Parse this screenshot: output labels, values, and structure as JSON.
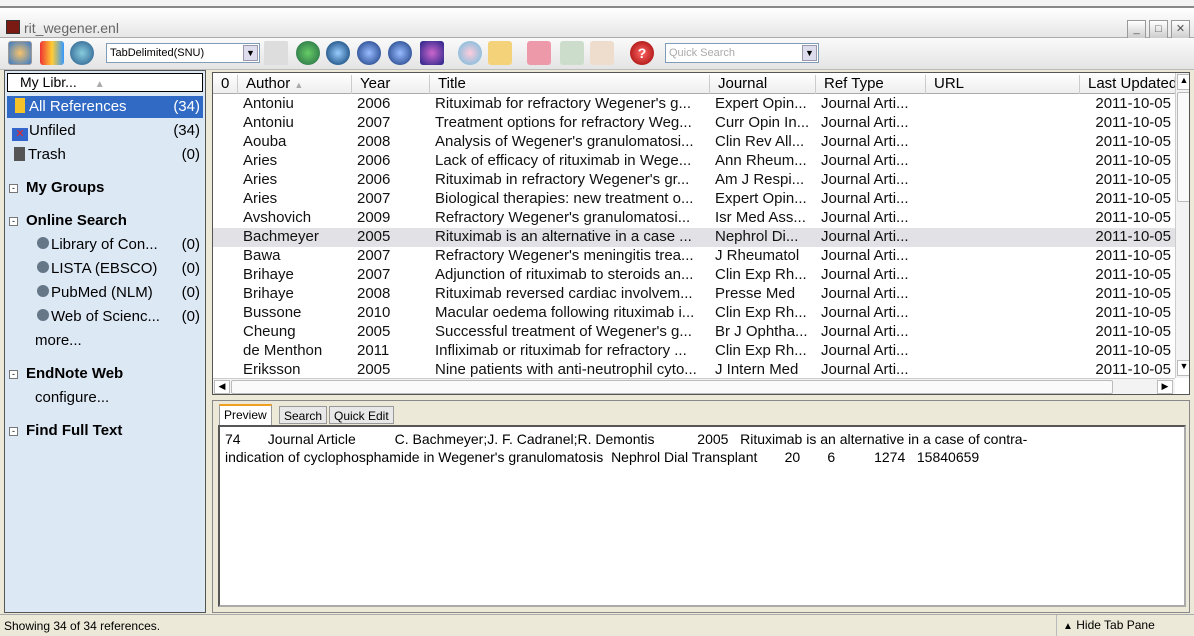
{
  "window": {
    "title": "rit_wegener.enl"
  },
  "toolbar": {
    "style_select": "TabDelimited(SNU)",
    "quick_search_placeholder": "Quick Search"
  },
  "sidebar": {
    "header": "My Libr...",
    "items": [
      {
        "label": "All References",
        "count": "(34)"
      },
      {
        "label": "Unfiled",
        "count": "(34)"
      },
      {
        "label": "Trash",
        "count": "(0)"
      }
    ],
    "groups": {
      "my_groups": "My Groups",
      "online_search": "Online Search",
      "endnote_web": "EndNote Web",
      "find_full_text": "Find Full Text"
    },
    "online": [
      {
        "label": "Library of Con...",
        "count": "(0)"
      },
      {
        "label": "LISTA (EBSCO)",
        "count": "(0)"
      },
      {
        "label": "PubMed (NLM)",
        "count": "(0)"
      },
      {
        "label": "Web of Scienc...",
        "count": "(0)"
      }
    ],
    "more": "more...",
    "configure": "configure..."
  },
  "table": {
    "columns": [
      "Author",
      "Year",
      "Title",
      "Journal",
      "Ref Type",
      "URL",
      "Last Updated"
    ],
    "selected_index": 7,
    "rows": [
      [
        "Antoniu",
        "2006",
        "Rituximab for refractory Wegener's g...",
        "Expert Opin...",
        "Journal Arti...",
        "",
        "2011-10-05"
      ],
      [
        "Antoniu",
        "2007",
        "Treatment options for refractory Weg...",
        "Curr Opin In...",
        "Journal Arti...",
        "",
        "2011-10-05"
      ],
      [
        "Aouba",
        "2008",
        "Analysis of Wegener's granulomatosi...",
        "Clin Rev All...",
        "Journal Arti...",
        "",
        "2011-10-05"
      ],
      [
        "Aries",
        "2006",
        "Lack of efficacy of rituximab in Wege...",
        "Ann Rheum...",
        "Journal Arti...",
        "",
        "2011-10-05"
      ],
      [
        "Aries",
        "2006",
        "Rituximab in refractory Wegener's gr...",
        "Am J Respi...",
        "Journal Arti...",
        "",
        "2011-10-05"
      ],
      [
        "Aries",
        "2007",
        "Biological therapies: new treatment o...",
        "Expert Opin...",
        "Journal Arti...",
        "",
        "2011-10-05"
      ],
      [
        "Avshovich",
        "2009",
        "Refractory Wegener's granulomatosi...",
        "Isr Med Ass...",
        "Journal Arti...",
        "",
        "2011-10-05"
      ],
      [
        "Bachmeyer",
        "2005",
        "Rituximab is an alternative in a case ...",
        "Nephrol Di...",
        "Journal Arti...",
        "",
        "2011-10-05"
      ],
      [
        "Bawa",
        "2007",
        "Refractory Wegener's meningitis trea...",
        "J Rheumatol",
        "Journal Arti...",
        "",
        "2011-10-05"
      ],
      [
        "Brihaye",
        "2007",
        "Adjunction of rituximab to steroids an...",
        "Clin Exp Rh...",
        "Journal Arti...",
        "",
        "2011-10-05"
      ],
      [
        "Brihaye",
        "2008",
        "Rituximab reversed cardiac involvem...",
        "Presse Med",
        "Journal Arti...",
        "",
        "2011-10-05"
      ],
      [
        "Bussone",
        "2010",
        "Macular oedema following rituximab i...",
        "Clin Exp Rh...",
        "Journal Arti...",
        "",
        "2011-10-05"
      ],
      [
        "Cheung",
        "2005",
        "Successful treatment of Wegener's g...",
        "Br J Ophtha...",
        "Journal Arti...",
        "",
        "2011-10-05"
      ],
      [
        "de Menthon",
        "2011",
        "Infliximab or rituximab for refractory ...",
        "Clin Exp Rh...",
        "Journal Arti...",
        "",
        "2011-10-05"
      ],
      [
        "Eriksson",
        "2005",
        "Nine patients with anti-neutrophil cyto...",
        "J Intern Med",
        "Journal Arti...",
        "",
        "2011-10-05"
      ]
    ]
  },
  "tabs": [
    "Preview",
    "Search",
    "Quick Edit"
  ],
  "preview": {
    "line1": "74       Journal Article          C. Bachmeyer;J. F. Cadranel;R. Demontis           2005   Rituximab is an alternative in a case of contra-",
    "line2": "indication of cyclophosphamide in Wegener's granulomatosis  Nephrol Dial Transplant       20       6          1274   15840659"
  },
  "status": {
    "text": "Showing 34 of 34 references.",
    "hide_tab_pane": "Hide Tab Pane"
  },
  "colors": {
    "selection": "#316ac5",
    "sidebar_bg": "#dde8f5",
    "row_selected": "#e1e1e6"
  }
}
